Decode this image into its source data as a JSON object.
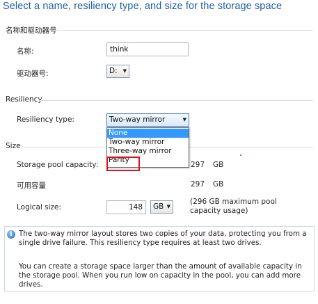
{
  "title": "Select a name, resiliency type, and size for the storage space",
  "name_group": {
    "heading": "名称和驱动器号",
    "name_label": "名称:",
    "name_value": "think",
    "drive_label": "驱动器号:",
    "drive_value": "D:"
  },
  "resiliency_group": {
    "heading": "Resiliency",
    "type_label": "Resiliency type:",
    "type_value": "Two-way mirror",
    "options": [
      "None",
      "Two-way mirror",
      "Three-way mirror",
      "Parity"
    ],
    "selected_option_index": 0
  },
  "size_group": {
    "heading": "Size",
    "pool_capacity_label": "Storage pool capacity:",
    "pool_capacity_value": "297",
    "pool_capacity_unit": "GB",
    "available_label": "可用容量",
    "available_value": "297",
    "available_unit": "GB",
    "logical_size_label": "Logical size:",
    "logical_size_value": "148",
    "logical_size_unit": "GB",
    "logical_size_note": "(296 GB maximum pool capacity usage)"
  },
  "info": {
    "paragraph1": "The two-way mirror layout stores two copies of your data, protecting you from a single drive failure. This resiliency type requires at least two drives.",
    "paragraph2": "You can create a storage space larger than the amount of available capacity in the storage pool. When you run low on capacity in the pool, you can add more drives."
  },
  "colors": {
    "title": "#1f5fa8",
    "highlight_border": "#e0101a",
    "selection": "#3399ff"
  }
}
